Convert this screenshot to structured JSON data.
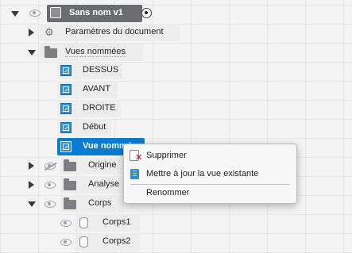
{
  "tree": {
    "root": {
      "label": "Sans nom v1"
    },
    "document_settings": {
      "label": "Paramètres du document"
    },
    "named_views": {
      "label": "Vues nommées",
      "items": [
        {
          "label": "DESSUS"
        },
        {
          "label": "AVANT"
        },
        {
          "label": "DROITE"
        },
        {
          "label": "Début"
        },
        {
          "label": "Vue nommée"
        }
      ]
    },
    "origin": {
      "label": "Origine"
    },
    "analysis": {
      "label": "Analyse"
    },
    "bodies": {
      "label": "Corps",
      "items": [
        {
          "label": "Corps1"
        },
        {
          "label": "Corps2"
        }
      ]
    }
  },
  "context_menu": {
    "items": [
      {
        "label": "Supprimer"
      },
      {
        "label": "Mettre à jour la vue existante"
      },
      {
        "label": "Renommer"
      }
    ]
  },
  "colors": {
    "selection": "#0a7bd3",
    "view_icon": "#2f8fd1",
    "background": "#f4f4f4"
  }
}
